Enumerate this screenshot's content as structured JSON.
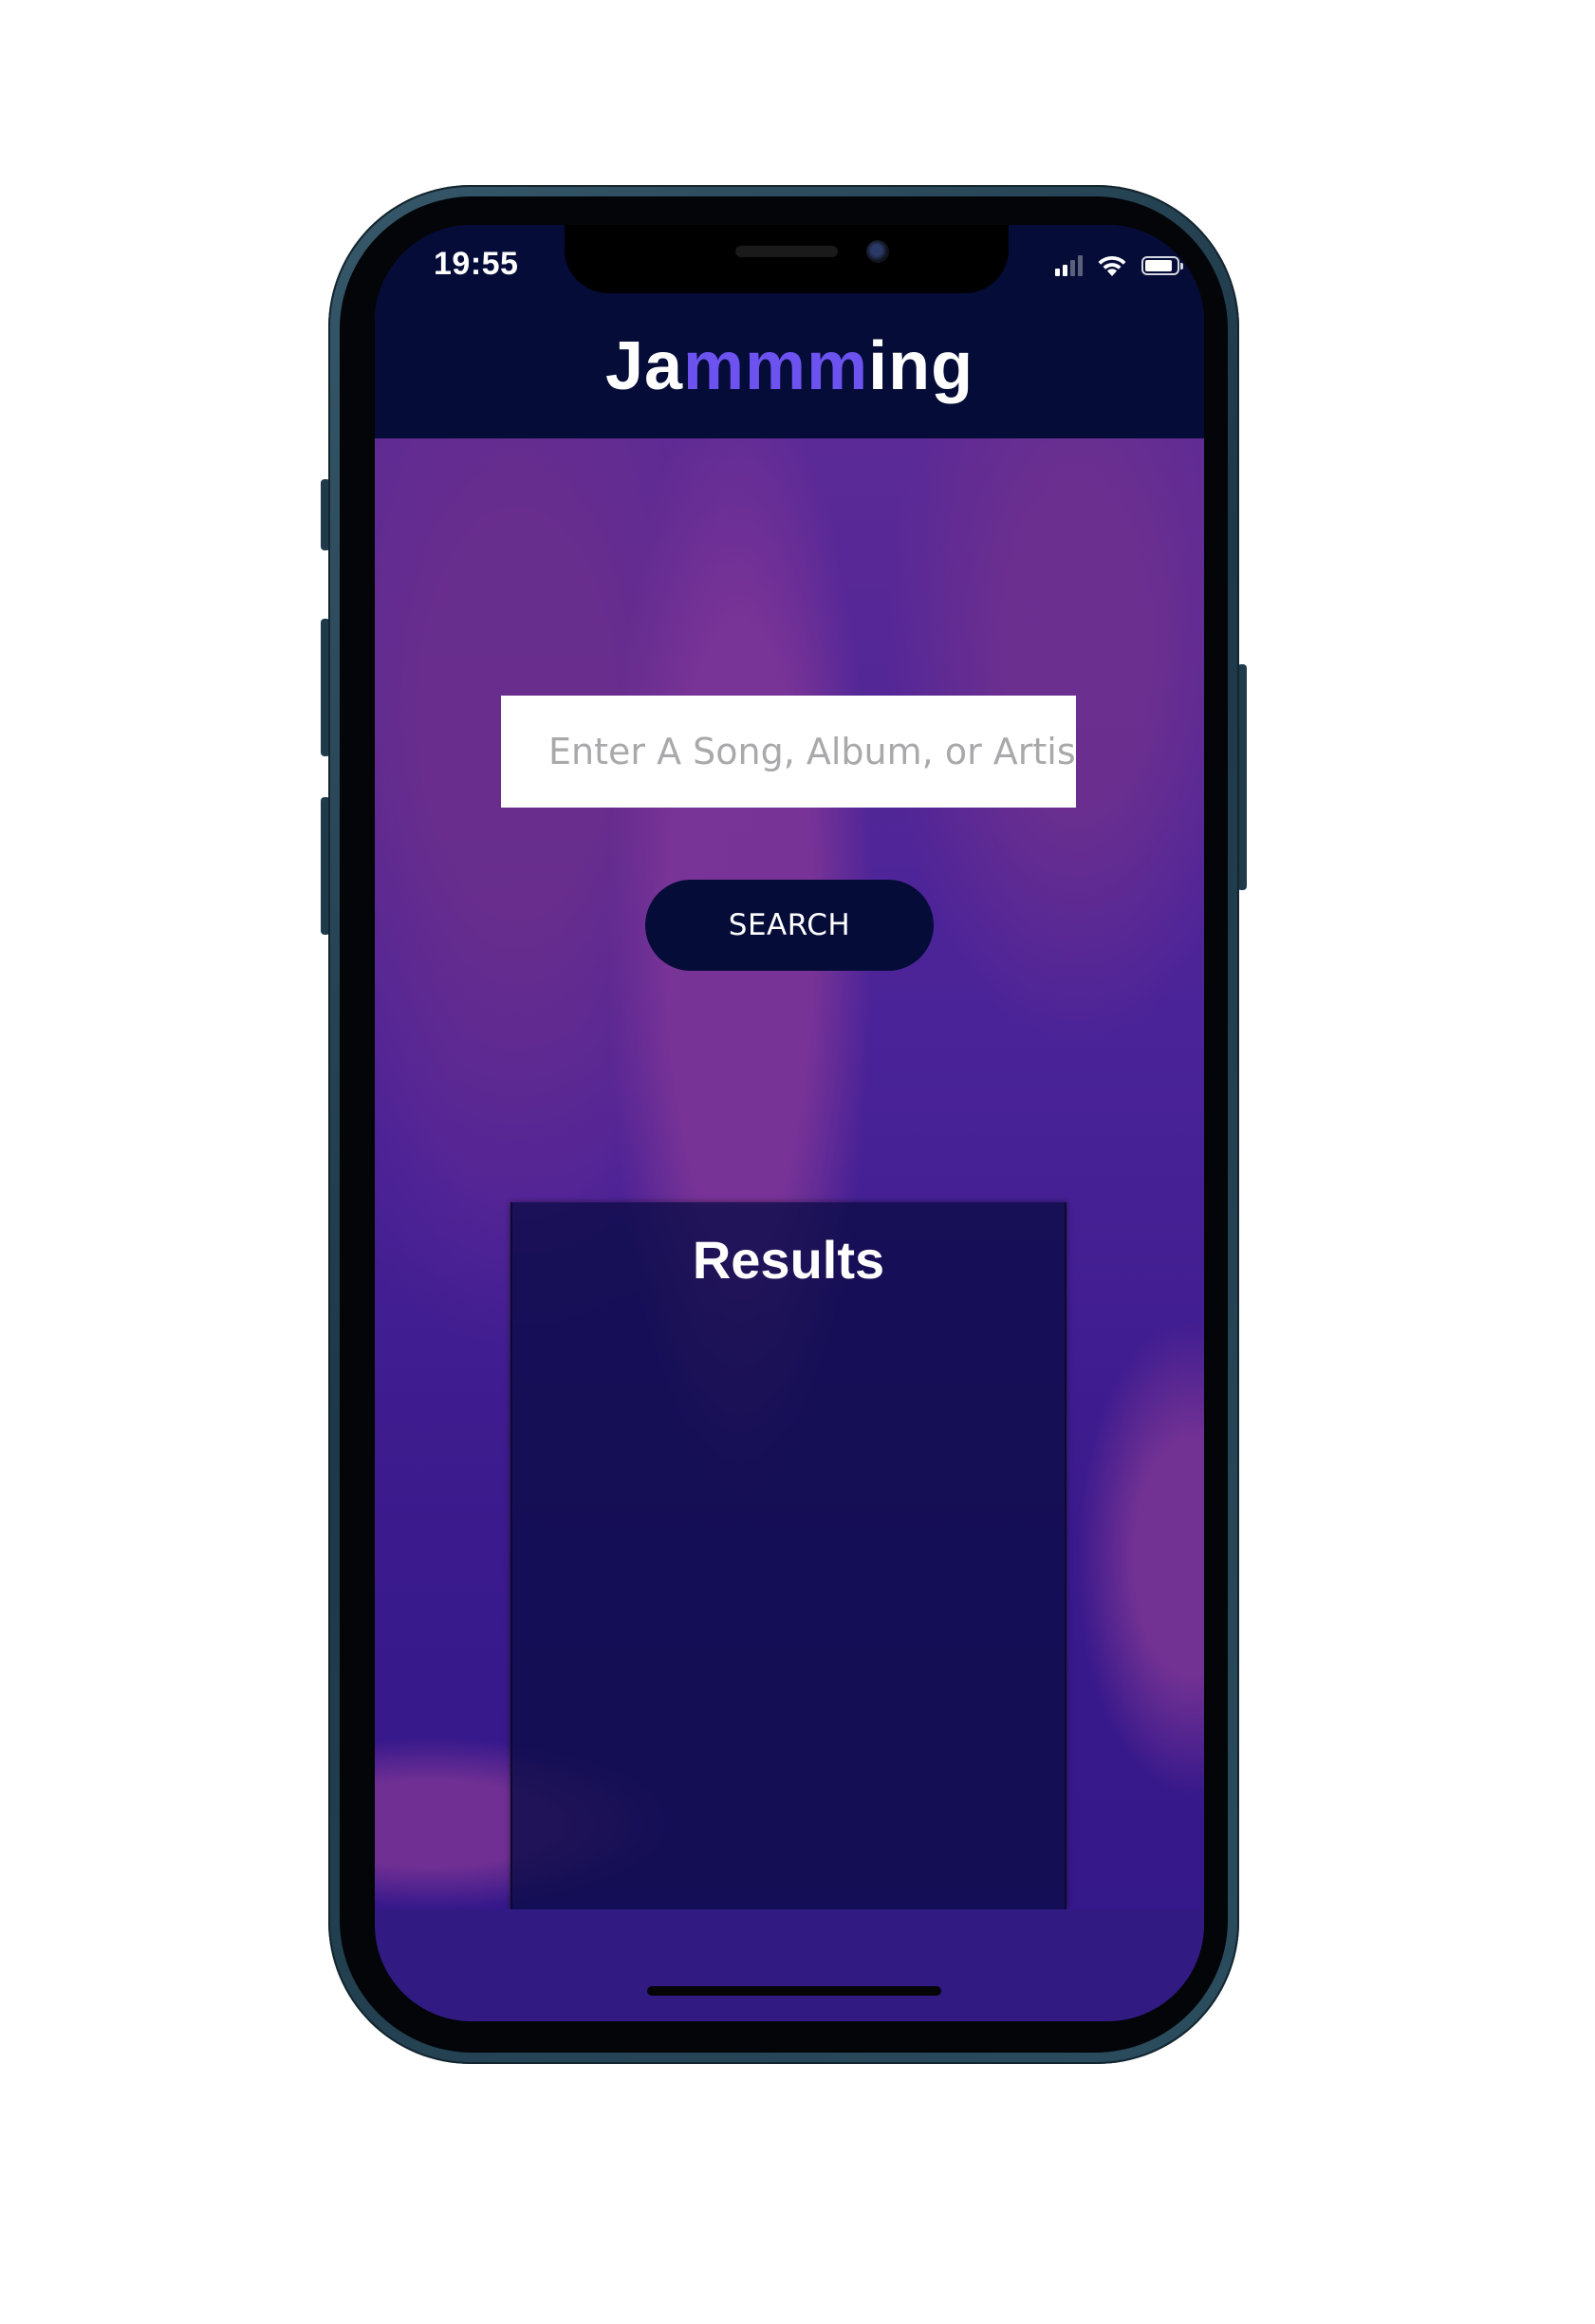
{
  "status_bar": {
    "time": "19:55"
  },
  "header": {
    "logo_prefix": "Ja",
    "logo_accent": "mmm",
    "logo_suffix": "ing"
  },
  "search": {
    "placeholder": "Enter A Song, Album, or Artist",
    "value": "",
    "button_label": "SEARCH"
  },
  "results": {
    "title": "Results",
    "items": []
  },
  "colors": {
    "header_bg": "#050c38",
    "logo_accent": "#6c52ef",
    "button_bg": "#050c38",
    "page_bg": "#311a82",
    "results_panel_bg": "#0a0c46"
  },
  "icons": [
    "cellular-signal-icon",
    "wifi-icon",
    "battery-icon"
  ]
}
